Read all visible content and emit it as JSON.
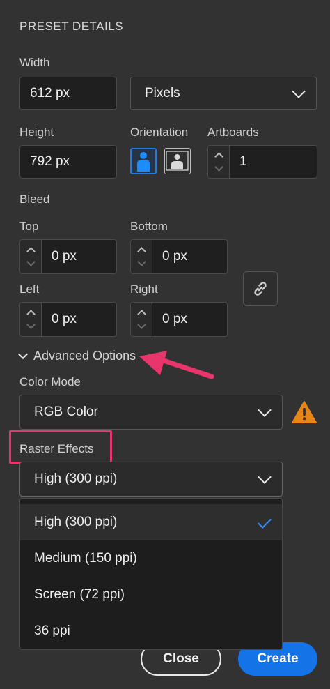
{
  "section_title": "PRESET DETAILS",
  "width": {
    "label": "Width",
    "value": "612 px",
    "unit": "Pixels"
  },
  "height": {
    "label": "Height",
    "value": "792 px"
  },
  "orientation": {
    "label": "Orientation"
  },
  "artboards": {
    "label": "Artboards",
    "value": "1"
  },
  "bleed": {
    "label": "Bleed",
    "top": {
      "label": "Top",
      "value": "0 px"
    },
    "bottom": {
      "label": "Bottom",
      "value": "0 px"
    },
    "left": {
      "label": "Left",
      "value": "0 px"
    },
    "right": {
      "label": "Right",
      "value": "0 px"
    }
  },
  "advanced_options": {
    "label": "Advanced Options"
  },
  "color_mode": {
    "label": "Color Mode",
    "value": "RGB Color"
  },
  "raster_effects": {
    "label": "Raster Effects",
    "value": "High (300 ppi)",
    "options": [
      "High (300 ppi)",
      "Medium (150 ppi)",
      "Screen (72 ppi)",
      "36 ppi"
    ]
  },
  "buttons": {
    "close": "Close",
    "create": "Create"
  },
  "colors": {
    "accent": "#1473e6",
    "highlight": "#e8356b",
    "warning": "#e68619"
  }
}
